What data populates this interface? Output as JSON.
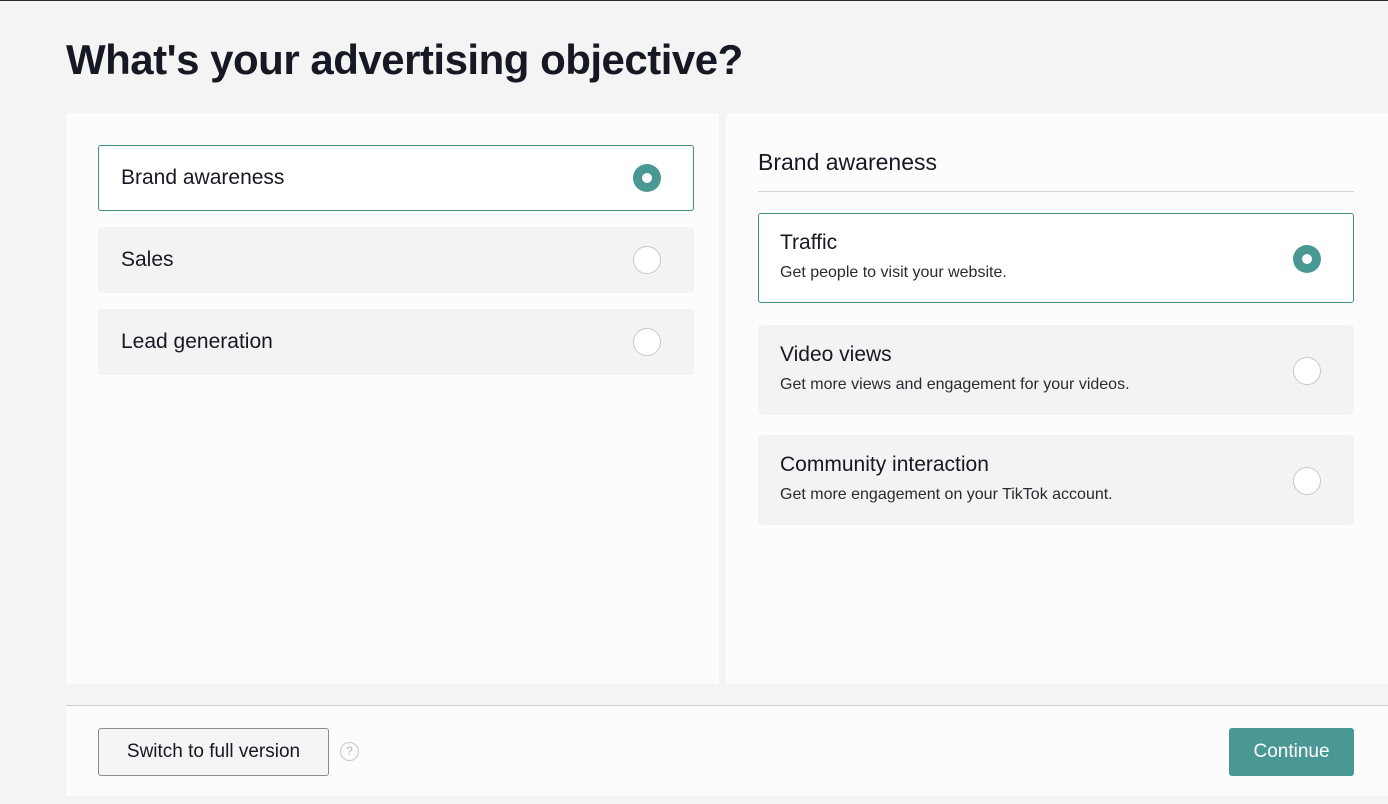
{
  "page": {
    "title": "What's your advertising objective?"
  },
  "objectives": [
    {
      "label": "Brand awareness",
      "selected": true
    },
    {
      "label": "Sales",
      "selected": false
    },
    {
      "label": "Lead generation",
      "selected": false
    }
  ],
  "detail": {
    "heading": "Brand awareness",
    "options": [
      {
        "title": "Traffic",
        "description": "Get people to visit your website.",
        "selected": true
      },
      {
        "title": "Video views",
        "description": "Get more views and engagement for your videos.",
        "selected": false
      },
      {
        "title": "Community interaction",
        "description": "Get more engagement on your TikTok account.",
        "selected": false
      }
    ]
  },
  "footer": {
    "switch_label": "Switch to full version",
    "help_glyph": "?",
    "continue_label": "Continue"
  },
  "colors": {
    "accent": "#4a9894",
    "selected_border": "#3d8d89",
    "option_bg": "#f3f3f3",
    "page_bg": "#f4f4f4"
  }
}
